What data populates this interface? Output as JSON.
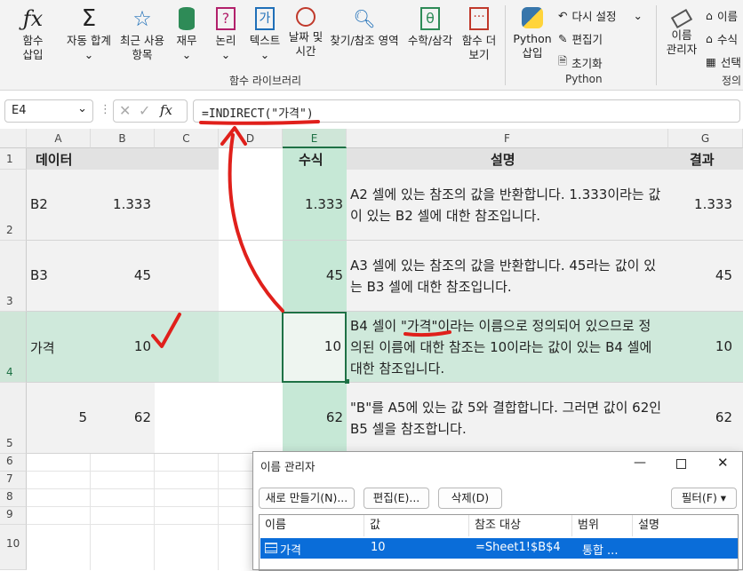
{
  "ribbon": {
    "insert_function": "함수\n삽입",
    "autosum": "자동 합계",
    "recent": "최근 사용\n항목",
    "finance": "재무",
    "logical": "논리",
    "text": "텍스트",
    "datetime": "날짜 및\n시간",
    "lookup": "찾기/참조 영역",
    "math": "수학/삼각",
    "more": "함수 더\n보기",
    "group_label": "함수 라이브러리",
    "python_btn": "Python\n삽입",
    "undo_settings": "다시 설정",
    "editor": "편집기",
    "init": "초기화",
    "python_group": "Python",
    "name_mgr": "이름\n관리자",
    "define_name": "이름",
    "use_formula": "수식",
    "create_sel": "선택",
    "define_group": "정의"
  },
  "formula_bar": {
    "name_box": "E4",
    "fx": "fx",
    "formula": "=INDIRECT(\"가격\")"
  },
  "columns": [
    "A",
    "B",
    "C",
    "D",
    "E",
    "F",
    "G"
  ],
  "rows": [
    "1",
    "2",
    "3",
    "4",
    "5",
    "6",
    "7",
    "8",
    "9",
    "10"
  ],
  "sheet": {
    "a1": "데이터",
    "e1": "수식",
    "f1": "설명",
    "g1": "결과",
    "a2": "B2",
    "b2": "1.333",
    "e2": "1.333",
    "f2": "A2 셀에 있는 참조의 값을 반환합니다. 1.333이라는 값이 있는 B2 셀에 대한 참조입니다.",
    "g2": "1.333",
    "a3": "B3",
    "b3": "45",
    "e3": "45",
    "f3": "A3 셀에 있는 참조의 값을 반환합니다. 45라는 값이 있는 B3 셀에 대한 참조입니다.",
    "g3": "45",
    "a4": "가격",
    "b4": "10",
    "e4": "10",
    "f4a": "B4 셀이 ",
    "f4b": "\"가격\"",
    "f4c": "이라는 이름으로 정의되어 있으므로 정의된 이름에 대한 참조는 10이라는 값이 있는 B4 셀에 대한 참조입니다.",
    "g4": "10",
    "a5": "5",
    "b5": "62",
    "e5": "62",
    "f5": "\"B\"를 A5에 있는 값 5와 결합합니다. 그러면 값이 62인 B5 셀을 참조합니다.",
    "g5": "62"
  },
  "dialog": {
    "title": "이름 관리자",
    "new_btn": "새로 만들기(N)...",
    "edit_btn": "편집(E)...",
    "delete_btn": "삭제(D)",
    "filter_btn": "필터(F) ▾",
    "col_name": "이름",
    "col_value": "값",
    "col_ref": "참조 대상",
    "col_scope": "범위",
    "col_comment": "설명",
    "row_name": "가격",
    "row_value": "10",
    "row_ref": "=Sheet1!$B$4",
    "row_scope": "통합 ..."
  },
  "colors": {
    "accent_green": "#1e7145",
    "selected_col": "#c6e8d6",
    "highlight_row": "#d9efe3",
    "annotation_red": "#e0201b",
    "selection_blue": "#0a6dd9"
  }
}
